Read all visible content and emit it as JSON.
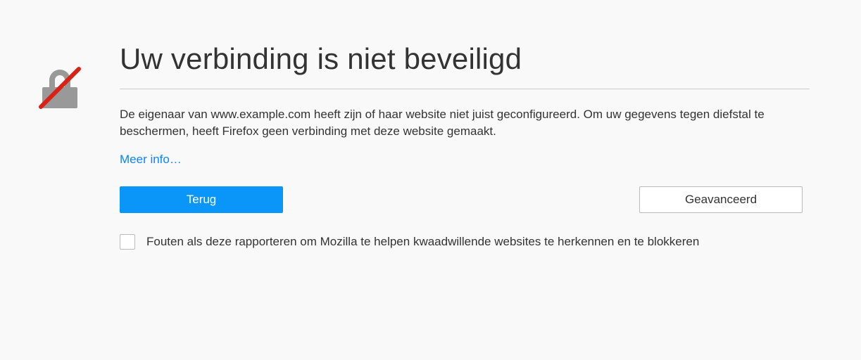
{
  "title": "Uw verbinding is niet beveiligd",
  "description": "De eigenaar van www.example.com heeft zijn of haar website niet juist geconfigureerd. Om uw gegevens tegen diefstal te beschermen, heeft Firefox geen verbinding met deze website gemaakt.",
  "more_info_label": "Meer info…",
  "back_button_label": "Terug",
  "advanced_button_label": "Geavanceerd",
  "report_checkbox_label": "Fouten als deze rapporteren om Mozilla te helpen kwaadwillende websites te herkennen en te blokkeren"
}
